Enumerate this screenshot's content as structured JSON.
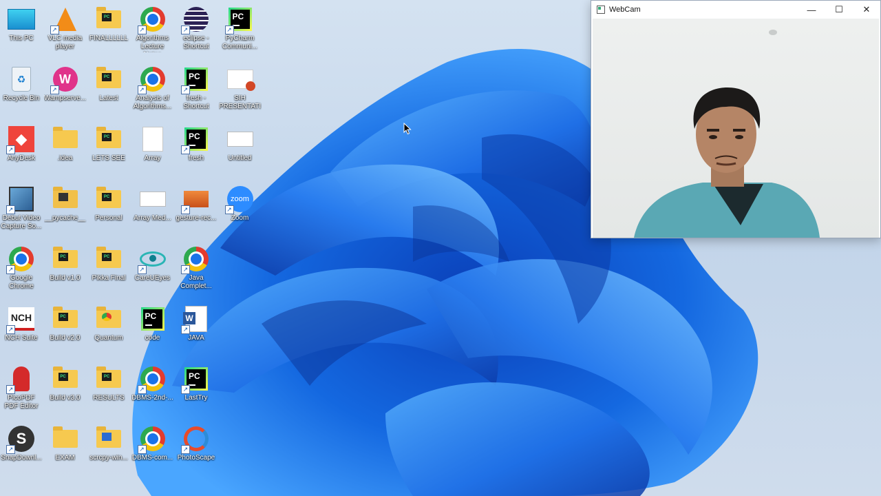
{
  "desktop": {
    "icons": [
      {
        "label": "This PC",
        "type": "thispc"
      },
      {
        "label": "VLC media player",
        "type": "vlc"
      },
      {
        "label": "FINALLLLLL",
        "type": "folder-pc"
      },
      {
        "label": "Algorithms Lecture Notes",
        "type": "chrome"
      },
      {
        "label": "eclipse - Shortcut",
        "type": "eclipse"
      },
      {
        "label": "PyCharm Communi...",
        "type": "pycharm"
      },
      {
        "label": "Recycle Bin",
        "type": "recycle"
      },
      {
        "label": "Wampserve...",
        "type": "wamp"
      },
      {
        "label": "Latest",
        "type": "folder-pc"
      },
      {
        "label": "Analysis of Algorithms...",
        "type": "chrome"
      },
      {
        "label": "fresh - Shortcut",
        "type": "pycharm"
      },
      {
        "label": "SIH PRESENTATI...",
        "type": "ppt"
      },
      {
        "label": "AnyDesk",
        "type": "anydesk"
      },
      {
        "label": ".idea",
        "type": "folder"
      },
      {
        "label": "LETS SEE",
        "type": "folder-pc"
      },
      {
        "label": "Array",
        "type": "doc"
      },
      {
        "label": "fresh",
        "type": "pycharm"
      },
      {
        "label": "Untitled",
        "type": "blank"
      },
      {
        "label": "Debut Video Capture So...",
        "type": "debut"
      },
      {
        "label": "__pycache__",
        "type": "folder-dark"
      },
      {
        "label": "Personal",
        "type": "folder-pc"
      },
      {
        "label": "Array Med...",
        "type": "blank"
      },
      {
        "label": "gesture-rec...",
        "type": "gesture"
      },
      {
        "label": "Zoom",
        "type": "zoom"
      },
      {
        "label": "Google Chrome",
        "type": "chrome"
      },
      {
        "label": "Build v1.0",
        "type": "folder-pc"
      },
      {
        "label": "Pikka Final",
        "type": "folder-pc"
      },
      {
        "label": "CareUEyes",
        "type": "eye"
      },
      {
        "label": "Java Complet...",
        "type": "chrome"
      },
      {
        "label": "",
        "type": "none"
      },
      {
        "label": "NCH Suite",
        "type": "nch"
      },
      {
        "label": "Build v2.0",
        "type": "folder-pc"
      },
      {
        "label": "Quantum",
        "type": "folder-chrome"
      },
      {
        "label": "code",
        "type": "pycharm"
      },
      {
        "label": "JAVA",
        "type": "word"
      },
      {
        "label": "",
        "type": "none"
      },
      {
        "label": "PicoPDF PDF Editor",
        "type": "pico"
      },
      {
        "label": "Build v3.0",
        "type": "folder-pc"
      },
      {
        "label": "RESULTS",
        "type": "folder-pc"
      },
      {
        "label": "DBMS-2nd-...",
        "type": "chrome"
      },
      {
        "label": "LastTry",
        "type": "pycharm"
      },
      {
        "label": "",
        "type": "none"
      },
      {
        "label": "SnapDownl...",
        "type": "snap"
      },
      {
        "label": "EXAM",
        "type": "folder"
      },
      {
        "label": "scrcpy-win...",
        "type": "folder-blue"
      },
      {
        "label": "DBMS-com...",
        "type": "chrome"
      },
      {
        "label": "PhotoScape",
        "type": "photoscape"
      },
      {
        "label": "",
        "type": "none"
      }
    ]
  },
  "webcam_window": {
    "title": "WebCam",
    "minimize_glyph": "—",
    "maximize_glyph": "☐",
    "close_glyph": "✕"
  },
  "icon_text": {
    "pycharm": "PC",
    "zoom": "zoom",
    "word": "W",
    "nch": "NCH",
    "snap": "S",
    "folder_pc": "PC",
    "shortcut_arrow": "↗"
  },
  "colors": {
    "bloom_dark": "#0a4bd0",
    "bloom_light": "#3fa0ff",
    "shirt": "#5aa8b4"
  }
}
